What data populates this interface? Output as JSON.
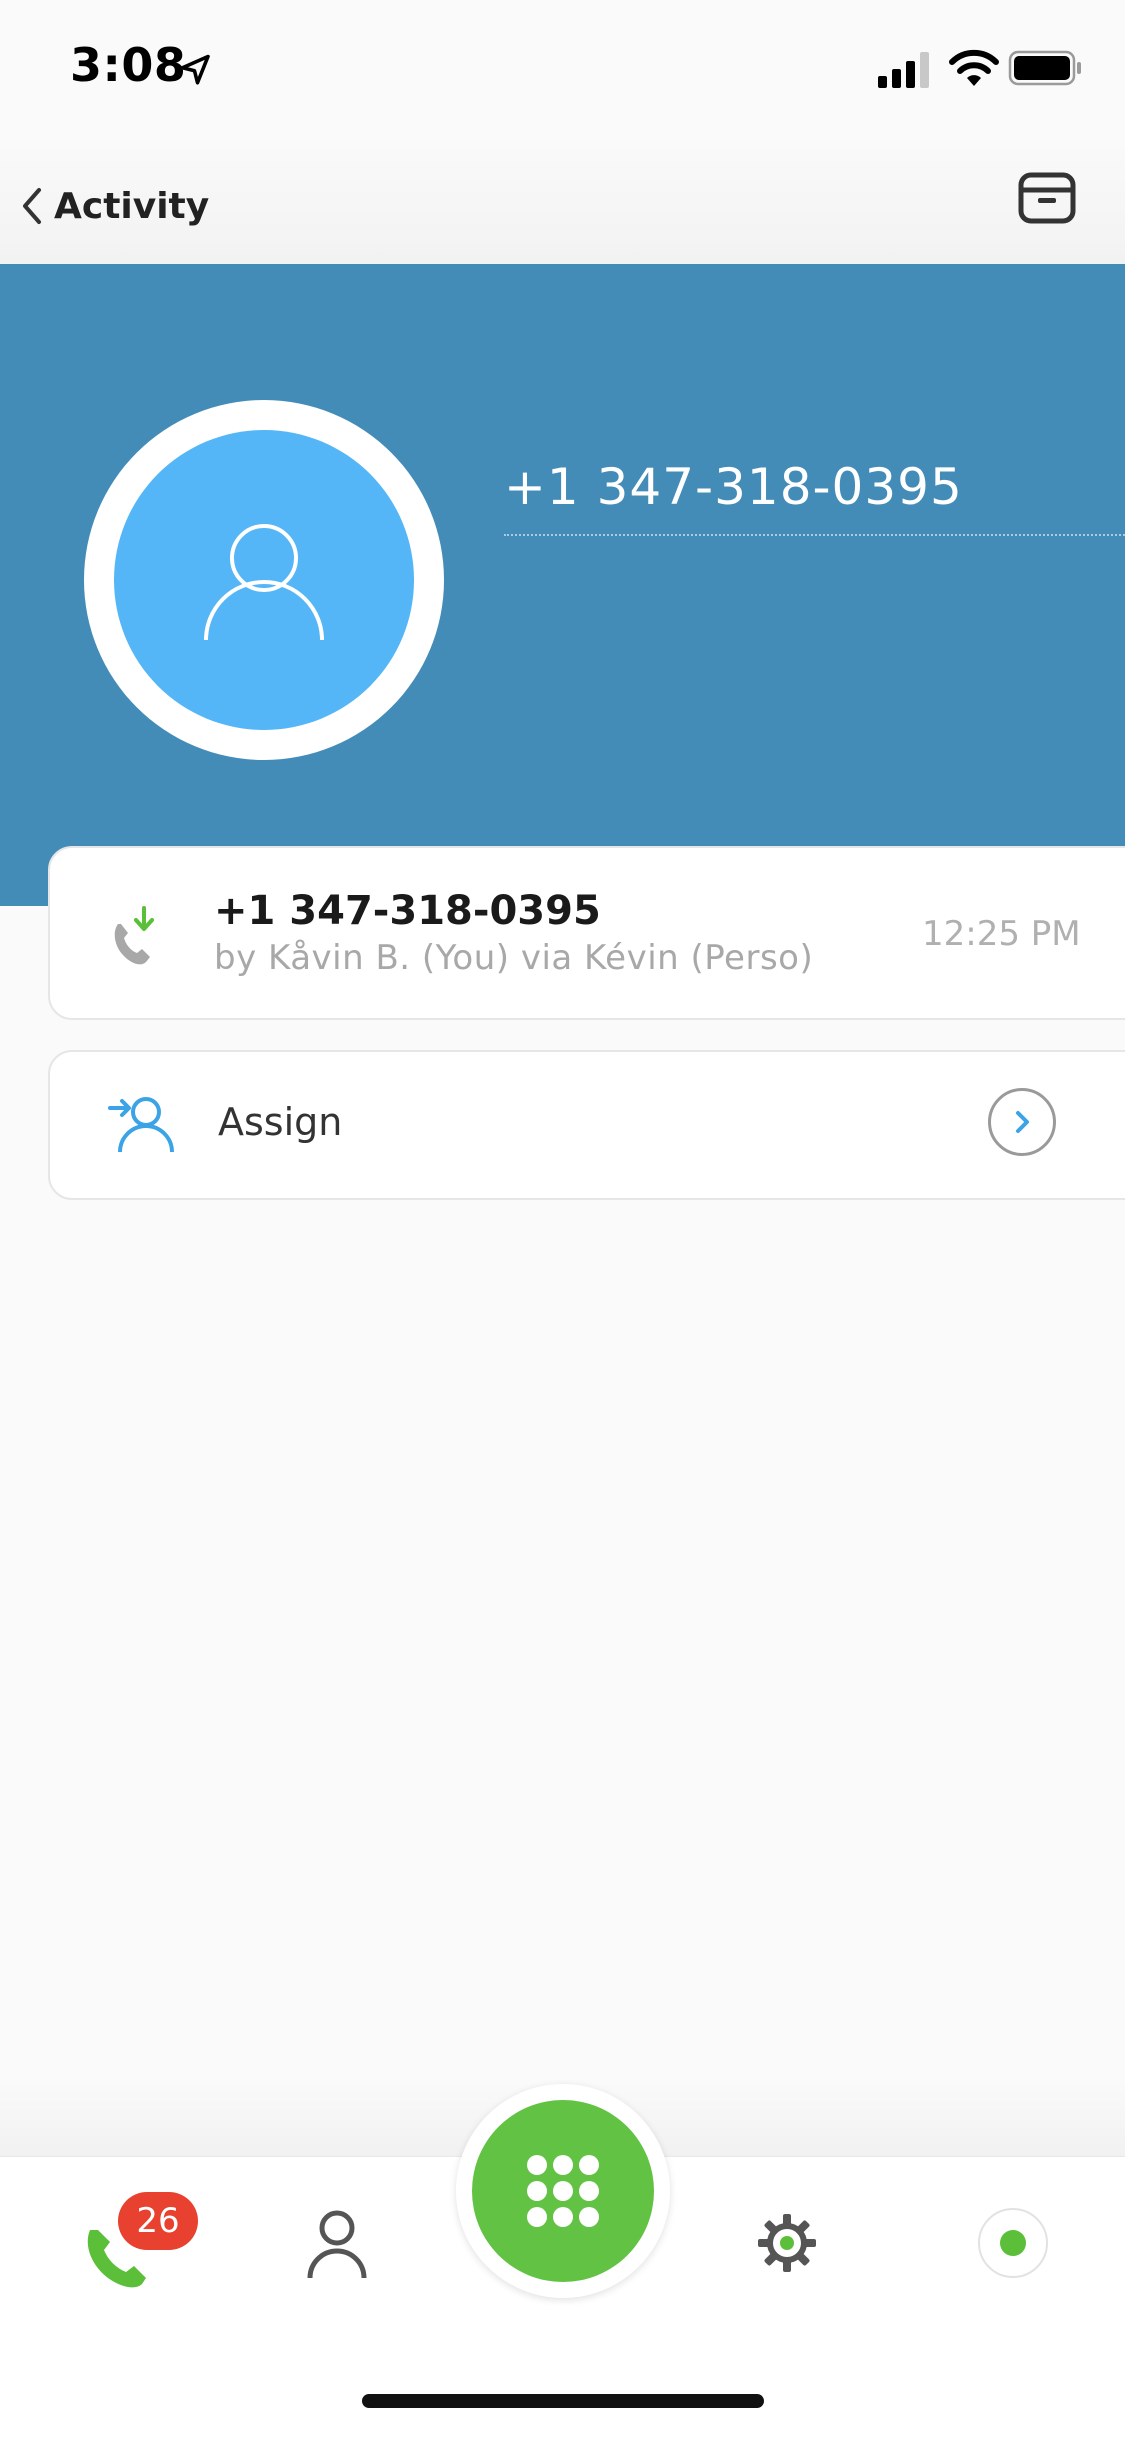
{
  "status_bar": {
    "time": "3:08"
  },
  "nav": {
    "back_label": "Activity"
  },
  "contact": {
    "number": "+1 347-318-0395"
  },
  "call": {
    "number": "+1 347-318-0395",
    "subtitle": "by Kåvin B. (You) via Kévin (Perso)",
    "time": "12:25 PM"
  },
  "assign": {
    "label": "Assign"
  },
  "tabs": {
    "calls_badge": "26"
  },
  "colors": {
    "header_bg": "#448cb8",
    "avatar_bg": "#54b6f6",
    "green": "#62c243",
    "badge_red": "#e8412f"
  },
  "icons": [
    "location-arrow-icon",
    "signal-icon",
    "wifi-icon",
    "battery-icon",
    "chevron-left-icon",
    "archive-icon",
    "person-icon",
    "incoming-call-icon",
    "assign-user-icon",
    "chevron-right-icon",
    "phone-icon",
    "contacts-icon",
    "dialpad-icon",
    "gear-icon",
    "status-dot-icon"
  ]
}
